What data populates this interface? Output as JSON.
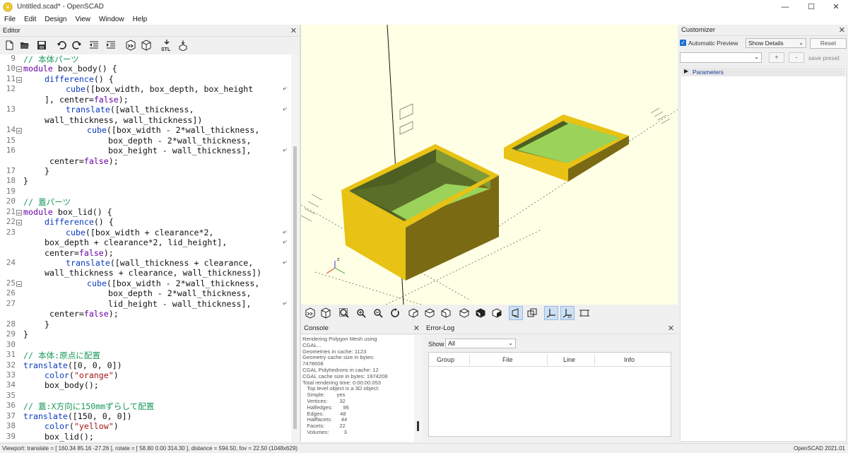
{
  "window": {
    "title": "Untitled.scad* - OpenSCAD",
    "minimize": "—",
    "maximize": "☐",
    "close": "✕"
  },
  "menu": [
    "File",
    "Edit",
    "Design",
    "View",
    "Window",
    "Help"
  ],
  "editor": {
    "title": "Editor",
    "close": "✕",
    "lines": [
      {
        "n": "9",
        "fold": false,
        "indent": 0,
        "html": "<span class=\"cm\">// 本体パーツ</span>"
      },
      {
        "n": "10",
        "fold": true,
        "indent": 0,
        "html": "<span class=\"kw\">module</span> box_body() {"
      },
      {
        "n": "11",
        "fold": true,
        "indent": 1,
        "html": "<span class=\"fn\">difference</span>() {"
      },
      {
        "n": "12",
        "fold": false,
        "indent": 2,
        "html": "<span class=\"fn\">cube</span>([box_width, box_depth, box_height",
        "wrap": true
      },
      {
        "n": "",
        "fold": false,
        "indent": 1,
        "html": "], center=<span class=\"kw\">false</span>);"
      },
      {
        "n": "13",
        "fold": false,
        "indent": 2,
        "html": "<span class=\"fn\">translate</span>([wall_thickness,",
        "wrap": true
      },
      {
        "n": "",
        "fold": false,
        "indent": 1,
        "html": "wall_thickness, wall_thickness])"
      },
      {
        "n": "14",
        "fold": true,
        "indent": 3,
        "html": "<span class=\"fn\">cube</span>([box_width - 2*wall_thickness,"
      },
      {
        "n": "15",
        "fold": false,
        "indent": 4,
        "html": "box_depth - 2*wall_thickness,"
      },
      {
        "n": "16",
        "fold": false,
        "indent": 4,
        "html": "box_height - wall_thickness],",
        "wrap": true
      },
      {
        "n": "",
        "fold": false,
        "indent": 1,
        "html": " center=<span class=\"kw\">false</span>);"
      },
      {
        "n": "17",
        "fold": false,
        "indent": 1,
        "html": "}"
      },
      {
        "n": "18",
        "fold": false,
        "indent": 0,
        "html": "}"
      },
      {
        "n": "19",
        "fold": false,
        "indent": 0,
        "html": ""
      },
      {
        "n": "20",
        "fold": false,
        "indent": 0,
        "html": "<span class=\"cm\">// 蓋パーツ</span>"
      },
      {
        "n": "21",
        "fold": true,
        "indent": 0,
        "html": "<span class=\"kw\">module</span> box_lid() {"
      },
      {
        "n": "22",
        "fold": true,
        "indent": 1,
        "html": "<span class=\"fn\">difference</span>() {"
      },
      {
        "n": "23",
        "fold": false,
        "indent": 2,
        "html": "<span class=\"fn\">cube</span>([box_width + clearance*2,",
        "wrap": true
      },
      {
        "n": "",
        "fold": false,
        "indent": 1,
        "html": "box_depth + clearance*2, lid_height],",
        "wrap": true
      },
      {
        "n": "",
        "fold": false,
        "indent": 1,
        "html": "center=<span class=\"kw\">false</span>);"
      },
      {
        "n": "24",
        "fold": false,
        "indent": 2,
        "html": "<span class=\"fn\">translate</span>([wall_thickness + clearance,",
        "wrap": true
      },
      {
        "n": "",
        "fold": false,
        "indent": 1,
        "html": "wall_thickness + clearance, wall_thickness])"
      },
      {
        "n": "25",
        "fold": true,
        "indent": 3,
        "html": "<span class=\"fn\">cube</span>([box_width - 2*wall_thickness,"
      },
      {
        "n": "26",
        "fold": false,
        "indent": 4,
        "html": "box_depth - 2*wall_thickness,"
      },
      {
        "n": "27",
        "fold": false,
        "indent": 4,
        "html": "lid_height - wall_thickness],",
        "wrap": true
      },
      {
        "n": "",
        "fold": false,
        "indent": 1,
        "html": " center=<span class=\"kw\">false</span>);"
      },
      {
        "n": "28",
        "fold": false,
        "indent": 1,
        "html": "}"
      },
      {
        "n": "29",
        "fold": false,
        "indent": 0,
        "html": "}"
      },
      {
        "n": "30",
        "fold": false,
        "indent": 0,
        "html": ""
      },
      {
        "n": "31",
        "fold": false,
        "indent": 0,
        "html": "<span class=\"cm\">// 本体:原点に配置</span>"
      },
      {
        "n": "32",
        "fold": false,
        "indent": 0,
        "html": "<span class=\"fn\">translate</span>([0, 0, 0])"
      },
      {
        "n": "33",
        "fold": false,
        "indent": 1,
        "html": "<span class=\"fn\">color</span>(<span class=\"st\">\"orange\"</span>)"
      },
      {
        "n": "34",
        "fold": false,
        "indent": 1,
        "html": "box_body();"
      },
      {
        "n": "35",
        "fold": false,
        "indent": 0,
        "html": ""
      },
      {
        "n": "36",
        "fold": false,
        "indent": 0,
        "html": "<span class=\"cm\">// 蓋:X方向に150mmずらして配置</span>"
      },
      {
        "n": "37",
        "fold": false,
        "indent": 0,
        "html": "<span class=\"fn\">translate</span>([150, 0, 0])"
      },
      {
        "n": "38",
        "fold": false,
        "indent": 1,
        "html": "<span class=\"fn\">color</span>(<span class=\"st\">\"yellow\"</span>)"
      },
      {
        "n": "39",
        "fold": false,
        "indent": 1,
        "html": "box_lid();"
      }
    ],
    "text_lines": [
      "// 本体パーツ",
      "module box_body() {",
      "difference() {",
      "cube([box_width, box_depth, box_height",
      "], center=false);",
      "translate([wall_thickness,",
      "wall_thickness, wall_thickness])",
      "cube([box_width - 2*wall_thickness,",
      "box_depth - 2*wall_thickness,",
      "box_height - wall_thickness],",
      " center=false);",
      "}",
      "}",
      "",
      "// 蓋パーツ",
      "module box_lid() {",
      "difference() {",
      "cube([box_width + clearance*2,",
      "box_depth + clearance*2, lid_height],",
      "center=false);",
      "translate([wall_thickness + clearance,",
      "wall_thickness + clearance, wall_thickness])",
      "cube([box_width - 2*wall_thickness,",
      "box_depth - 2*wall_thickness,",
      "lid_height - wall_thickness],",
      " center=false);",
      "}",
      "}",
      "",
      "// 本体:原点に配置",
      "translate([0, 0, 0])",
      "color(\"orange\")",
      "box_body();",
      "",
      "// 蓋:X方向に150mmずらして配置",
      "translate([150, 0, 0])",
      "color(\"yellow\")",
      "box_lid();"
    ]
  },
  "viewport": {
    "colors": {
      "background": "#ffffe5",
      "body_wall": "#e8c214",
      "body_dark": "#7a6a14",
      "lid_outer": "#e8c214",
      "floor": "#9bd25a",
      "inner": "#5a6e28"
    },
    "axis_label_z": "z",
    "ruler_marks": [
      "100",
      "100",
      "100"
    ]
  },
  "customizer": {
    "title": "Customizer",
    "close": "✕",
    "auto_preview_label": "Automatic Preview",
    "auto_preview_checked": true,
    "show_details": "Show Details",
    "reset": "Reset",
    "preset_select": "",
    "add": "+",
    "remove": "-",
    "save_preset": "save preset",
    "section": "Parameters"
  },
  "console": {
    "title": "Console",
    "close": "✕",
    "lines": [
      "Rendering Polygon Mesh using",
      "CGAL...",
      "Geometries in cache: 1123",
      "Geometry cache size in bytes:",
      "7478608",
      "CGAL Polyhedrons in cache: 12",
      "CGAL cache size in bytes: 1974208",
      "Total rendering time: 0:00:00.053",
      "   Top level object is a 3D object:",
      "   Simple:        yes",
      "   Vertices:        32",
      "   Halfedges:       96",
      "   Edges:           48",
      "   Halffacets:      44",
      "   Facets:          22",
      "   Volumes:          3"
    ]
  },
  "errorlog": {
    "title": "Error-Log",
    "close": "✕",
    "show_label": "Show",
    "show_value": "All",
    "columns": [
      "Group",
      "File",
      "Line",
      "Info"
    ]
  },
  "statusbar": {
    "viewport": "Viewport: translate = [ 160.34 85.16 -27.26 ], rotate = [ 58.80 0.00 314.30 ], distance = 594.50, fov = 22.50 (1048x629)",
    "version": "OpenSCAD 2021.01"
  }
}
